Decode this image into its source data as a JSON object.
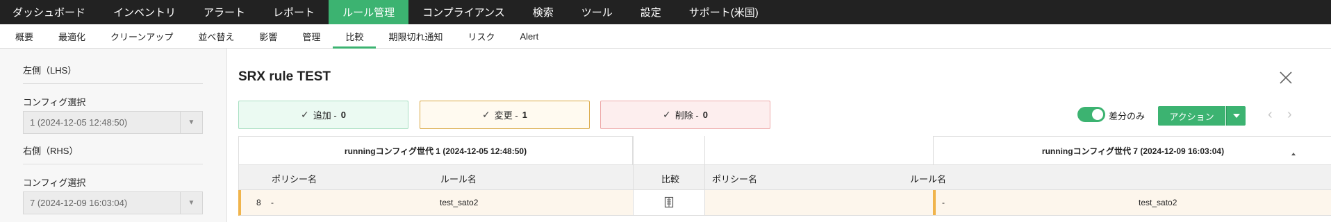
{
  "topnav": {
    "items": [
      "ダッシュボード",
      "インベントリ",
      "アラート",
      "レポート",
      "ルール管理",
      "コンプライアンス",
      "検索",
      "ツール",
      "設定",
      "サポート(米国)"
    ],
    "active": "ルール管理"
  },
  "subnav": {
    "items": [
      "概要",
      "最適化",
      "クリーンアップ",
      "並べ替え",
      "影響",
      "管理",
      "比較",
      "期限切れ通知",
      "リスク",
      "Alert"
    ],
    "active": "比較"
  },
  "left": {
    "lhs_heading": "左側（LHS）",
    "lhs_config_label": "コンフィグ選択",
    "lhs_config_value": "1 (2024-12-05 12:48:50)",
    "rhs_heading": "右側（RHS）",
    "rhs_config_label": "コンフィグ選択",
    "rhs_config_value": "7 (2024-12-09 16:03:04)"
  },
  "main": {
    "title": "SRX rule TEST",
    "summary": {
      "added_label": "追加 - ",
      "added_count": "0",
      "changed_label": "変更 - ",
      "changed_count": "1",
      "deleted_label": "削除 - ",
      "deleted_count": "0"
    },
    "diff_only_label": "差分のみ",
    "diff_only_on": true,
    "action_label": "アクション"
  },
  "table": {
    "lhs_generation": "runningコンフィグ世代 1 (2024-12-05 12:48:50)",
    "rhs_generation": "runningコンフィグ世代 7 (2024-12-09 16:03:04)",
    "columns": {
      "policy_name": "ポリシー名",
      "rule_name": "ルール名",
      "compare": "比較"
    },
    "rows": [
      {
        "no": "8",
        "lhs_policy": "-",
        "lhs_rule": "test_sato2",
        "rhs_policy": "-",
        "rhs_rule": "test_sato2",
        "status": "changed"
      }
    ]
  },
  "colors": {
    "accent": "#3cb371",
    "changed": "#f0b44c",
    "added_bg": "#ebfaf2",
    "deleted_bg": "#fdeeee"
  },
  "icons": [
    "check-icon",
    "close-icon",
    "chevron-left-icon",
    "chevron-right-icon",
    "caret-down-icon",
    "document-compare-icon"
  ]
}
